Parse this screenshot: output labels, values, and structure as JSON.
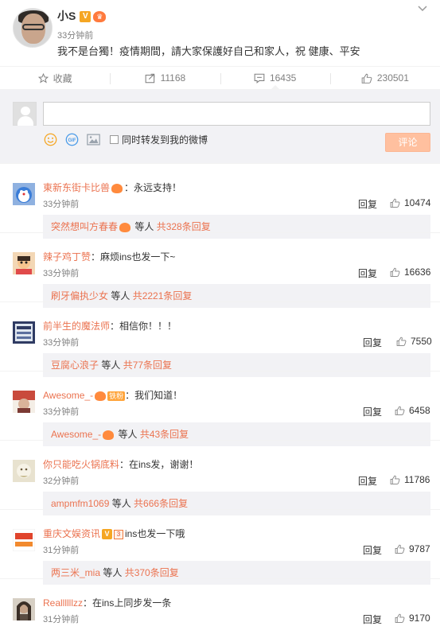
{
  "post": {
    "author": "小S",
    "time": "33分钟前",
    "text": "我不是台獨！疫情期間，請大家保護好自己和家人，祝  健康、平安"
  },
  "actions": {
    "favorite_label": "收藏",
    "repost_count": "11168",
    "comment_count": "16435",
    "like_count": "230501"
  },
  "compose": {
    "placeholder": "",
    "forward_label": "同时转发到我的微博",
    "submit_label": "评论"
  },
  "comments": [
    {
      "name": "東新东街卡比兽",
      "text": "：永远支持！",
      "time": "33分钟前",
      "reply_label": "回复",
      "likes": "10474",
      "sub_name": "突然想叫方春春",
      "sub_suffix": " 等人 ",
      "sub_count": "共328条回复",
      "avatar_color": "#6f8fc6"
    },
    {
      "name": "辣子鸡丁赞",
      "text": "：麻烦ins也发一下~",
      "time": "33分钟前",
      "reply_label": "回复",
      "likes": "16636",
      "sub_name": "刷牙偏执少女",
      "sub_suffix": " 等人 ",
      "sub_count": "共2221条回复",
      "avatar_color": "#e9b48a"
    },
    {
      "name": "前半生的魔法师",
      "text": "：相信你！！！",
      "time": "33分钟前",
      "reply_label": "回复",
      "likes": "7550",
      "sub_name": "豆腐心浪子",
      "sub_suffix": " 等人 ",
      "sub_count": "共77条回复",
      "avatar_color": "#4a5a8c"
    },
    {
      "name": "Awesome_-",
      "fan_badge": "铁粉",
      "text": "：我们知道！",
      "time": "33分钟前",
      "reply_label": "回复",
      "likes": "6458",
      "sub_name": "Awesome_-",
      "sub_suffix": " 等人 ",
      "sub_count": "共43条回复",
      "avatar_color": "#b25a4e"
    },
    {
      "name": "你只能吃火锅底料",
      "text": "：在ins发，谢谢！",
      "time": "32分钟前",
      "reply_label": "回复",
      "likes": "11786",
      "sub_name": "ampmfm1069",
      "sub_suffix": " 等人 ",
      "sub_count": "共666条回复",
      "avatar_color": "#cfc6a8"
    },
    {
      "name": "重庆文娱资讯",
      "v": "V",
      "flag": "3",
      "text": "ins也发一下哦",
      "time": "31分钟前",
      "reply_label": "回复",
      "likes": "9787",
      "sub_name": "两三米_mia",
      "sub_suffix": " 等人 ",
      "sub_count": "共370条回复",
      "avatar_color": "#e0442c"
    },
    {
      "name": "Reallllllzz",
      "text": "：在ins上同步发一条",
      "time": "31分钟前",
      "reply_label": "回复",
      "likes": "9170",
      "avatar_color": "#6b5c4e"
    }
  ]
}
